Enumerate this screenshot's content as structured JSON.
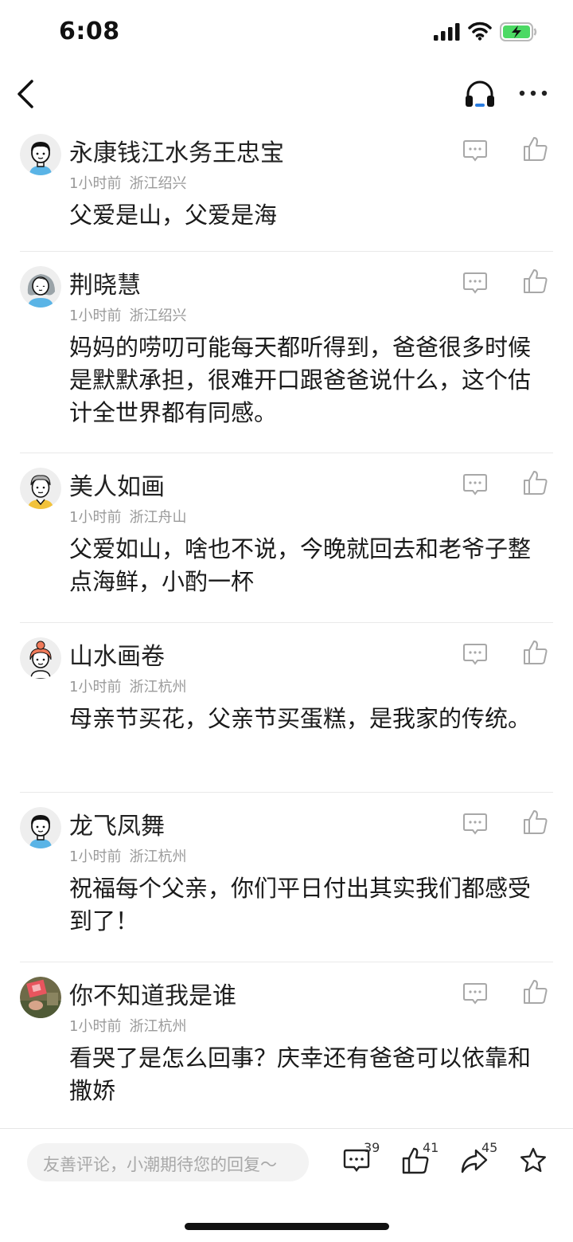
{
  "status_bar": {
    "time": "6:08"
  },
  "nav": {
    "back_icon": "chevron-left-icon",
    "listen_icon": "headphone-icon",
    "more_icon": "more-icon"
  },
  "comments": [
    {
      "name": "永康钱江水务王忠宝",
      "time": "1小时前",
      "location": "浙江绍兴",
      "text": "父爱是山，父爱是海",
      "avatar": "boy-avatar"
    },
    {
      "name": "荆晓慧",
      "time": "1小时前",
      "location": "浙江绍兴",
      "text": "妈妈的唠叨可能每天都听得到，爸爸很多时候是默默承担，很难开口跟爸爸说什么，这个估计全世界都有同感。",
      "avatar": "woman-avatar"
    },
    {
      "name": "美人如画",
      "time": "1小时前",
      "location": "浙江舟山",
      "text": "父爱如山，啥也不说，今晚就回去和老爷子整点海鲜，小酌一杯",
      "avatar": "elder-avatar"
    },
    {
      "name": "山水画卷",
      "time": "1小时前",
      "location": "浙江杭州",
      "text": "母亲节买花，父亲节买蛋糕，是我家的传统。",
      "avatar": "girl-avatar"
    },
    {
      "name": "龙飞凤舞",
      "time": "1小时前",
      "location": "浙江杭州",
      "text": "祝福每个父亲，你们平日付出其实我们都感受到了！",
      "avatar": "boy-avatar"
    },
    {
      "name": "你不知道我是谁",
      "time": "1小时前",
      "location": "浙江杭州",
      "text": "看哭了是怎么回事？庆幸还有爸爸可以依靠和撒娇",
      "avatar": "photo-avatar"
    }
  ],
  "bottom_bar": {
    "placeholder": "友善评论，小潮期待您的回复～",
    "comment_count": "39",
    "like_count": "41",
    "share_count": "45"
  },
  "colors": {
    "accent": "#2a7de1",
    "text": "#222222",
    "meta": "#9a9a9a",
    "battery": "#4cd964"
  }
}
